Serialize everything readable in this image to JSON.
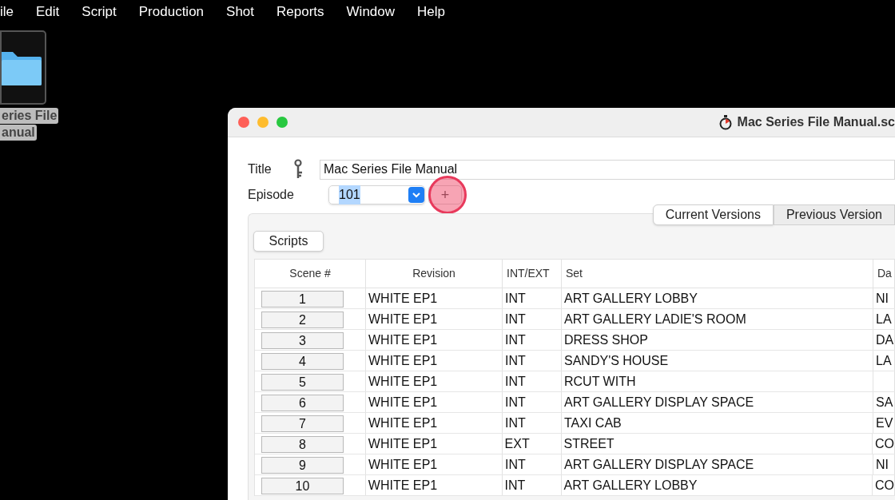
{
  "menu_bar": [
    "ile",
    "Edit",
    "Script",
    "Production",
    "Shot",
    "Reports",
    "Window",
    "Help"
  ],
  "desktop_icon": {
    "label_lines": [
      "eries File",
      "anual"
    ],
    "selected": true
  },
  "window": {
    "title": "Mac Series File Manual.sc",
    "title_label": "Title",
    "title_value": "Mac Series File Manual",
    "episode_label": "Episode",
    "episode_value": "101",
    "episode_value_selected": true,
    "add_button": "+",
    "click_highlight": true,
    "tabs": [
      {
        "label": "Current Versions",
        "selected": true
      },
      {
        "label": "Previous Version",
        "selected": false
      }
    ],
    "scripts_button": "Scripts",
    "table": {
      "columns": [
        "Scene #",
        "Revision",
        "INT/EXT",
        "Set",
        "Da"
      ],
      "rows": [
        {
          "scene": "1",
          "revision": "WHITE EP1",
          "int_ext": "INT",
          "set": "ART GALLERY LOBBY",
          "column_5": "NI"
        },
        {
          "scene": "2",
          "revision": "WHITE EP1",
          "int_ext": "INT",
          "set": "ART GALLERY LADIE'S ROOM",
          "column_5": "LA"
        },
        {
          "scene": "3",
          "revision": "WHITE EP1",
          "int_ext": "INT",
          "set": "DRESS SHOP",
          "column_5": "DA"
        },
        {
          "scene": "4",
          "revision": "WHITE EP1",
          "int_ext": "INT",
          "set": "SANDY'S HOUSE",
          "column_5": "LA"
        },
        {
          "scene": "5",
          "revision": "WHITE EP1",
          "int_ext": "INT",
          "set": "RCUT WITH"
        },
        {
          "scene": "6",
          "revision": "WHITE EP1",
          "int_ext": "INT",
          "set": "ART GALLERY DISPLAY SPACE",
          "column_5": "SA"
        },
        {
          "scene": "7",
          "revision": "WHITE EP1",
          "int_ext": "INT",
          "set": "TAXI CAB",
          "column_5": "EV"
        },
        {
          "scene": "8",
          "revision": "WHITE EP1",
          "int_ext": "EXT",
          "set": "STREET",
          "column_5": "CO"
        },
        {
          "scene": "9",
          "revision": "WHITE EP1",
          "int_ext": "INT",
          "set": "ART GALLERY DISPLAY SPACE",
          "column_5": "NI"
        },
        {
          "scene": "10",
          "revision": "WHITE EP1",
          "int_ext": "INT",
          "set": "ART GALLERY LOBBY",
          "column_5": "CO"
        }
      ]
    }
  }
}
